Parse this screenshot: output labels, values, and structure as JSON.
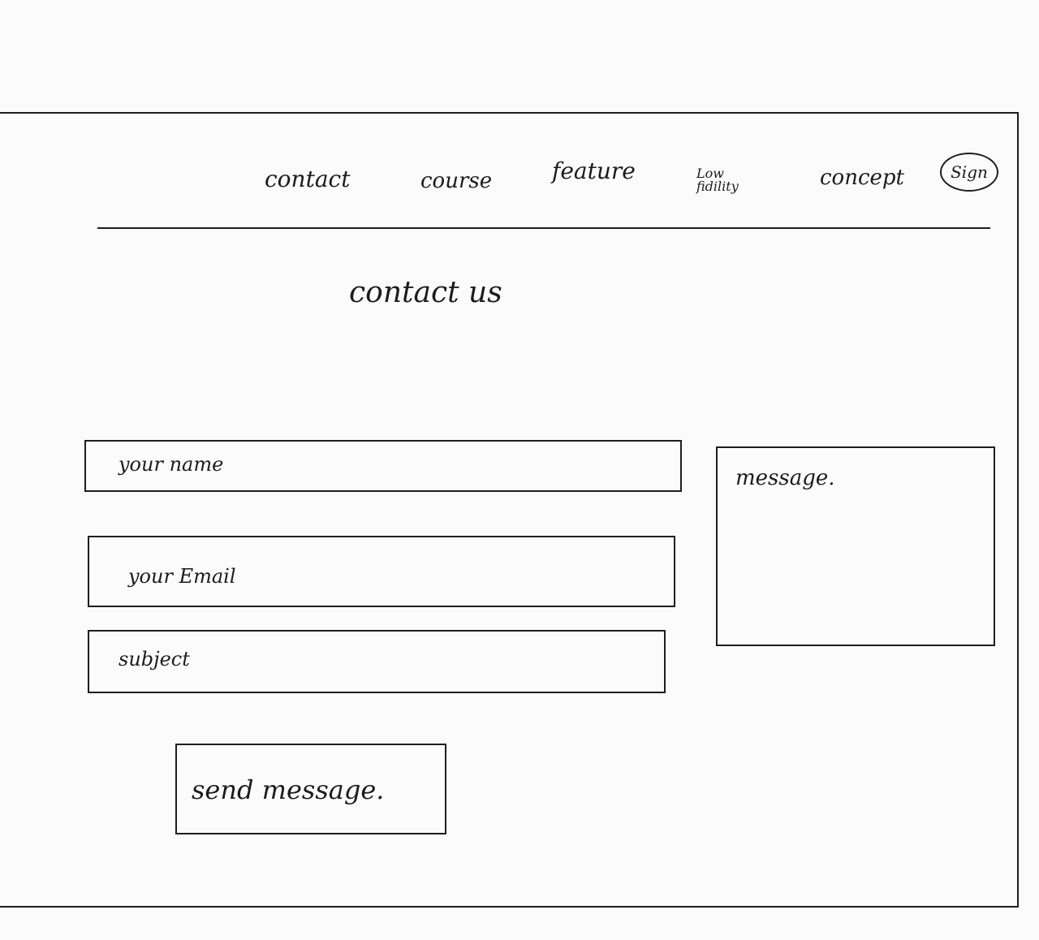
{
  "nav": {
    "items": [
      {
        "label": "contact"
      },
      {
        "label": "course"
      },
      {
        "label": "feature"
      },
      {
        "label_line1": "Low",
        "label_line2": "fidility"
      },
      {
        "label": "concept"
      }
    ],
    "sign_label": "Sign"
  },
  "page": {
    "title": "contact us"
  },
  "form": {
    "name_placeholder": "your name",
    "email_placeholder": "your Email",
    "subject_placeholder": "subject",
    "message_placeholder": "message.",
    "send_label": "send message."
  }
}
